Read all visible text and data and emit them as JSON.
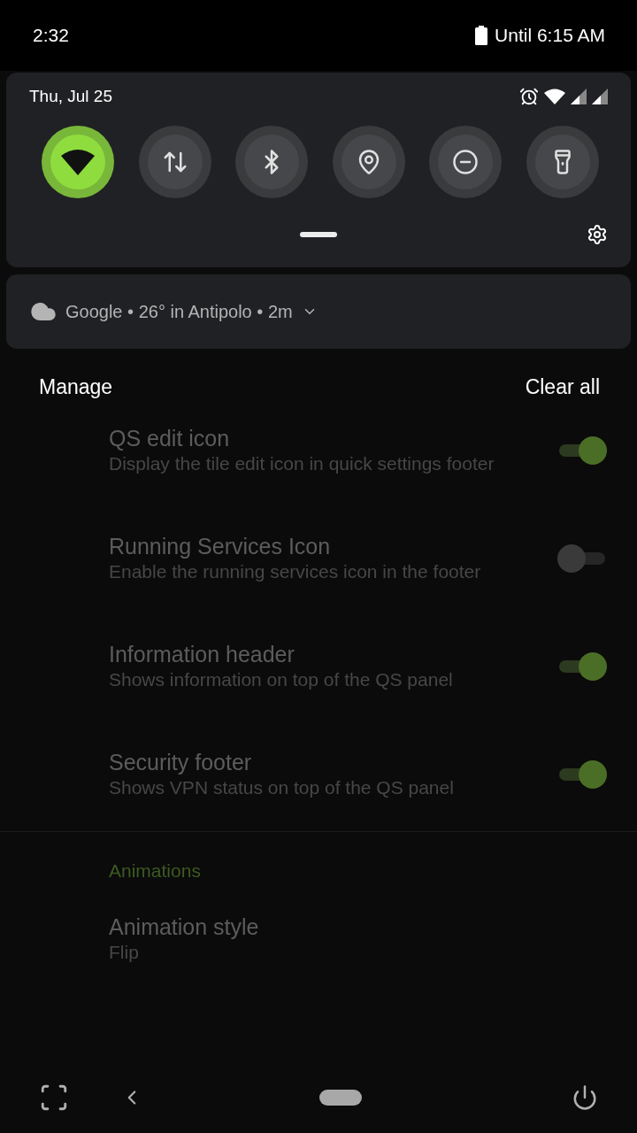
{
  "status_bar": {
    "time": "2:32",
    "battery_text": "Until 6:15 AM"
  },
  "quick_settings": {
    "date": "Thu, Jul 25",
    "tiles": [
      {
        "kind": "wifi",
        "on": true
      },
      {
        "kind": "data",
        "on": false
      },
      {
        "kind": "bluetooth",
        "on": false
      },
      {
        "kind": "location",
        "on": false
      },
      {
        "kind": "dnd",
        "on": false
      },
      {
        "kind": "flashlight",
        "on": false
      }
    ]
  },
  "notification": {
    "app": "Google",
    "text": "26° in Antipolo",
    "time": "2m",
    "separator": "•"
  },
  "notification_actions": {
    "manage": "Manage",
    "clear_all": "Clear all"
  },
  "settings": [
    {
      "kind": "toggle",
      "title": "QS edit icon",
      "summary": "Display the tile edit icon in quick settings footer",
      "on": true
    },
    {
      "kind": "toggle",
      "title": "Running Services Icon",
      "summary": "Enable the running services icon in the footer",
      "on": false
    },
    {
      "kind": "toggle",
      "title": "Information header",
      "summary": "Shows information on top of the QS panel",
      "on": true
    },
    {
      "kind": "toggle",
      "title": "Security footer",
      "summary": "Shows VPN status on top of the QS panel",
      "on": true
    },
    {
      "kind": "divider"
    },
    {
      "kind": "header",
      "title": "Animations"
    },
    {
      "kind": "value",
      "title": "Animation style",
      "summary": "Flip"
    }
  ]
}
